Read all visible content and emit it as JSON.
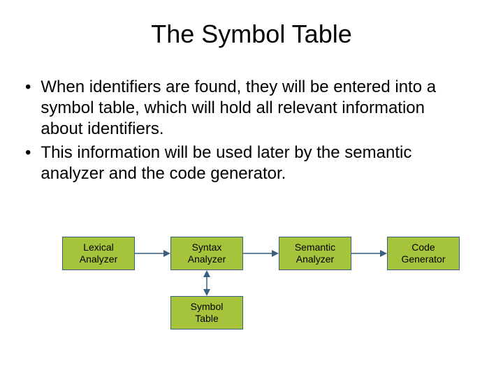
{
  "title": "The Symbol Table",
  "bullets": [
    "When identifiers are found, they will be entered into a symbol table, which will hold all relevant information about identifiers.",
    "This information will be used later by the semantic analyzer and the code generator."
  ],
  "boxes": {
    "lexical": "Lexical\nAnalyzer",
    "syntax": "Syntax\nAnalyzer",
    "semantic": "Semantic\nAnalyzer",
    "codegen": "Code\nGenerator",
    "symbol": "Symbol\nTable"
  }
}
